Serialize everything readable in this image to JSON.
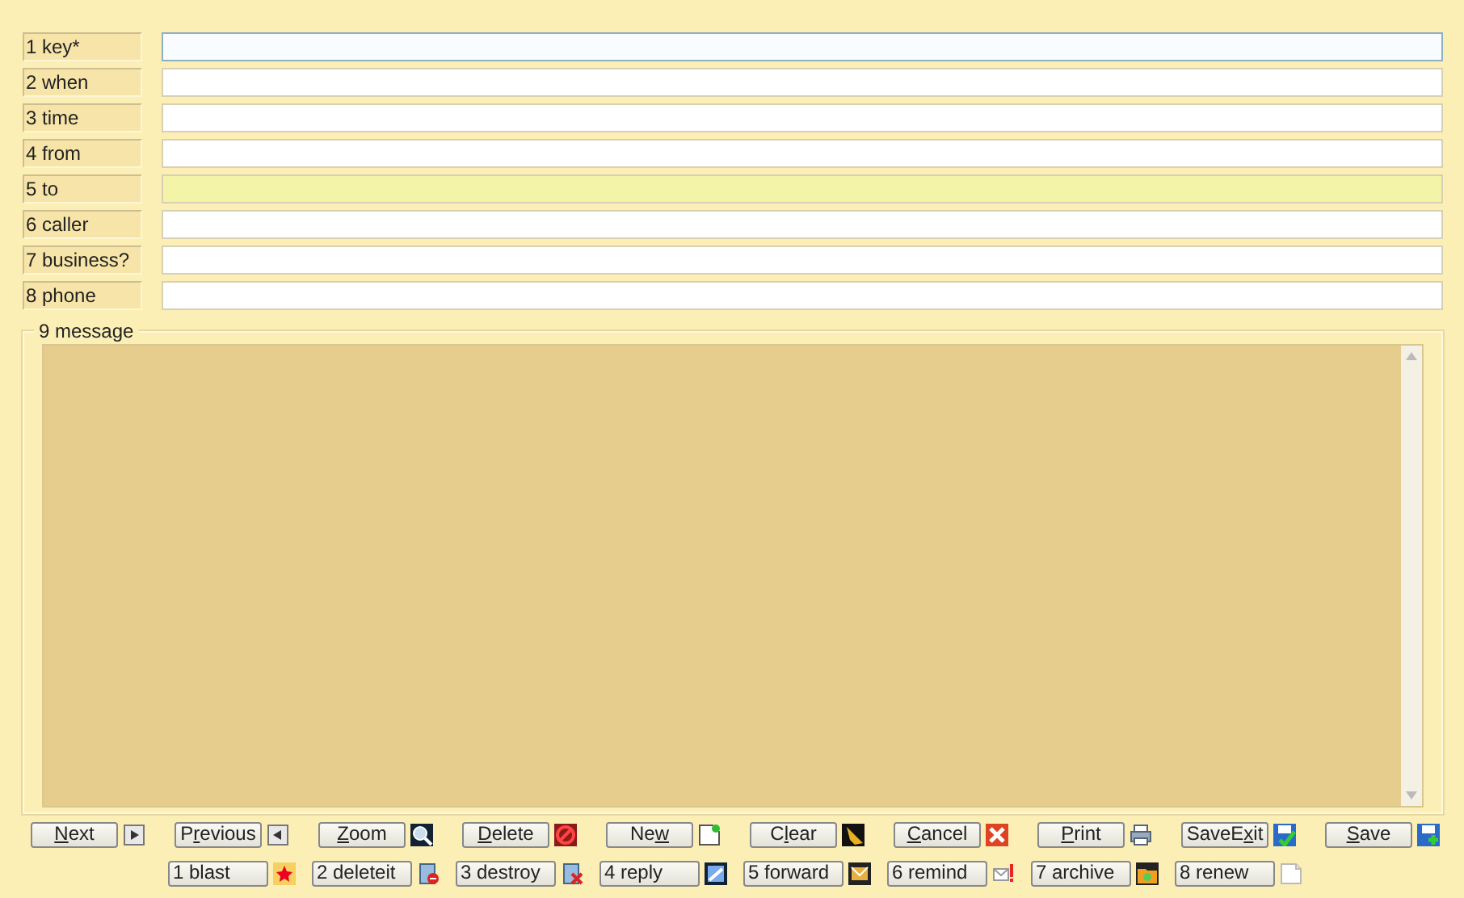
{
  "fields": [
    {
      "label": "1 key*",
      "focused": true,
      "highlighted": false
    },
    {
      "label": "2 when",
      "focused": false,
      "highlighted": false
    },
    {
      "label": "3 time",
      "focused": false,
      "highlighted": false
    },
    {
      "label": "4 from",
      "focused": false,
      "highlighted": false
    },
    {
      "label": "5 to",
      "focused": false,
      "highlighted": true
    },
    {
      "label": "6 caller",
      "focused": false,
      "highlighted": false
    },
    {
      "label": "7 business?",
      "focused": false,
      "highlighted": false
    },
    {
      "label": "8 phone",
      "focused": false,
      "highlighted": false
    }
  ],
  "message": {
    "legend": "9 message"
  },
  "commands": [
    {
      "key": "N",
      "post": "ext"
    },
    {
      "pre": "P",
      "key": "r",
      "post": "evious"
    },
    {
      "key": "Z",
      "post": "oom"
    },
    {
      "key": "D",
      "post": "elete"
    },
    {
      "pre": "Ne",
      "key": "w"
    },
    {
      "pre": "C",
      "key": "l",
      "post": "ear"
    },
    {
      "key": "C",
      "post": "ancel"
    },
    {
      "key": "P",
      "post": "rint"
    },
    {
      "pre": "SaveE",
      "key": "x",
      "post": "it"
    },
    {
      "key": "S",
      "post": "ave"
    }
  ],
  "actions": [
    {
      "label": "1 blast"
    },
    {
      "label": "2 deleteit"
    },
    {
      "label": "3 destroy"
    },
    {
      "label": "4 reply"
    },
    {
      "label": "5 forward"
    },
    {
      "label": "6 remind"
    },
    {
      "label": "7 archive"
    },
    {
      "label": "8 renew"
    }
  ]
}
